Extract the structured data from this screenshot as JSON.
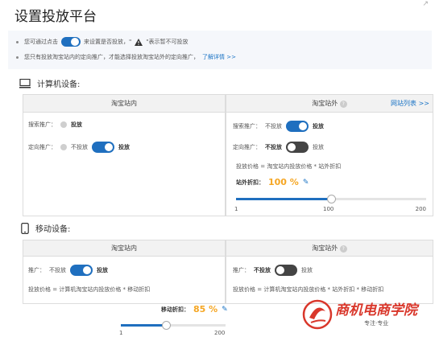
{
  "page": {
    "title": "设置投放平台",
    "corner_mark": "↗"
  },
  "notice": {
    "line1_pre": "您可通过点击",
    "line1_mid": "来设置是否投放，\"",
    "line1_post": "\"表示暂不可投放",
    "line2": "您只有投放淘宝站内的定向推广，才能选择投放淘宝站外的定向推广，",
    "line2_link": "了解详情 >>"
  },
  "computer": {
    "heading": "计算机设备:",
    "inside": {
      "title": "淘宝站内",
      "search_label": "搜索推广：",
      "search_value": "投放",
      "directed_label": "定向推广：",
      "directed_off": "不投放",
      "directed_on": "投放"
    },
    "outside": {
      "title": "淘宝站外",
      "site_list_link": "网站列表 >>",
      "search_label": "搜索推广：",
      "search_off": "不投放",
      "search_on": "投放",
      "directed_label": "定向推广：",
      "directed_off": "不投放",
      "directed_on": "投放",
      "formula": "投放价格 = 淘宝站内投放价格 * 站外折扣",
      "discount_label": "站外折扣：",
      "discount_value": "100 %",
      "discount_fraction": 0.5,
      "slider_min": "1",
      "slider_mid": "100",
      "slider_max": "200"
    }
  },
  "mobile": {
    "heading": "移动设备:",
    "inside": {
      "title": "淘宝站内",
      "promo_label": "推广：",
      "promo_off": "不投放",
      "promo_on": "投放",
      "formula": "投放价格 = 计算机淘宝站内投放价格 * 移动折扣",
      "discount_label": "移动折扣：",
      "discount_value": "85 %",
      "discount_fraction": 0.43,
      "slider_min": "1",
      "slider_mid": "200"
    },
    "outside": {
      "title": "淘宝站外",
      "promo_label": "推广：",
      "promo_off": "不投放",
      "promo_on": "投放",
      "formula": "投放价格 = 计算机淘宝站内投放价格 * 站外折扣 * 移动折扣"
    }
  },
  "logo": {
    "name": "商机电商学院",
    "tagline": "专注·专业"
  },
  "colors": {
    "accent": "#1f6fbf",
    "orange": "#f5a623",
    "logo_red": "#d9372b"
  }
}
